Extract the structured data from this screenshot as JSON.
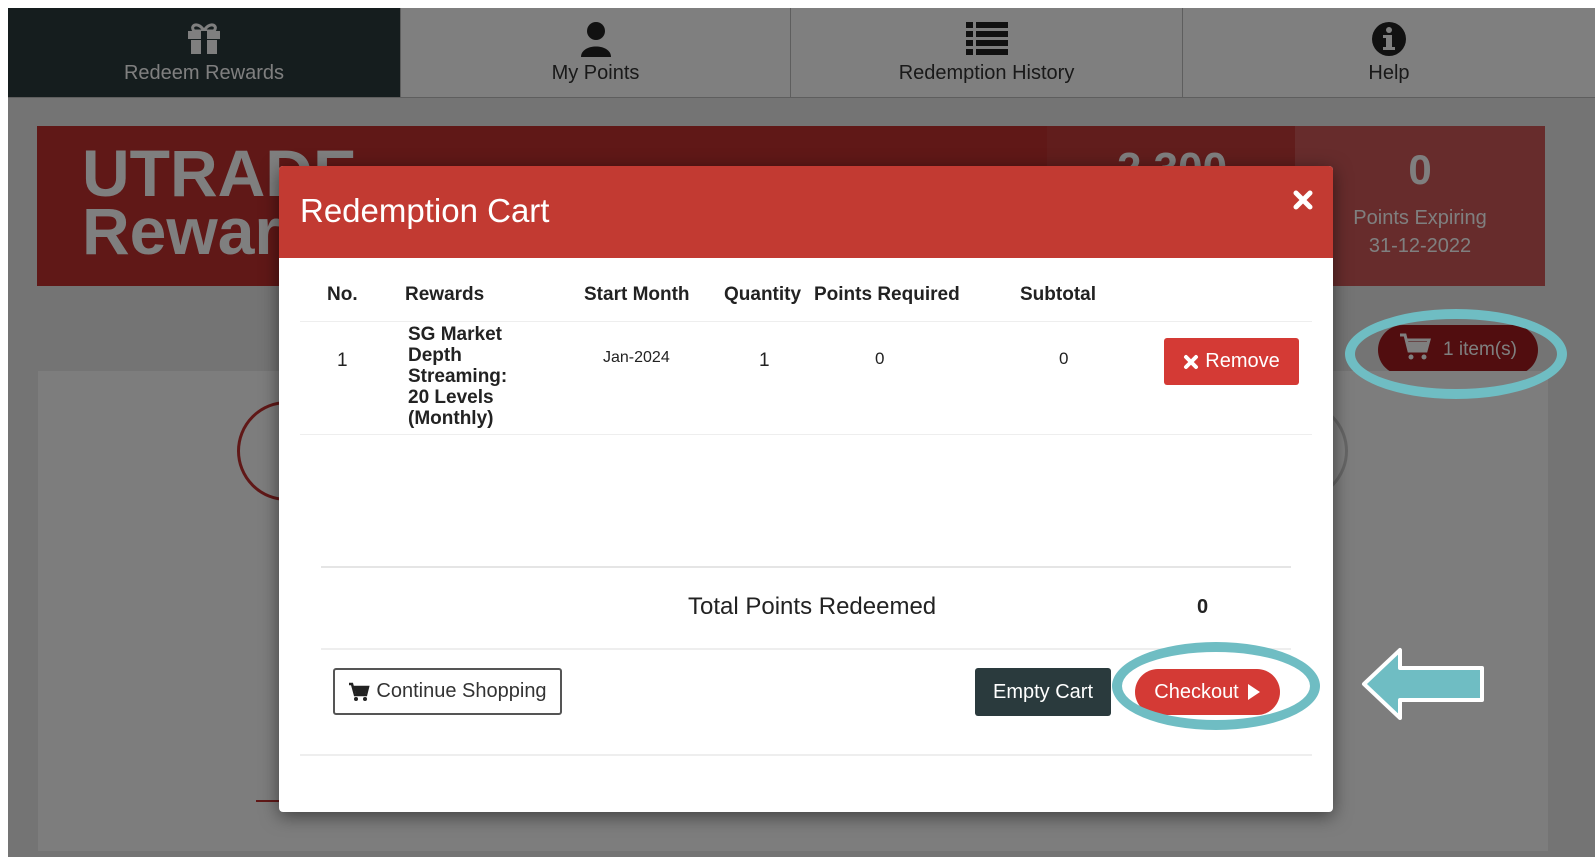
{
  "nav": {
    "tabs": [
      {
        "label": "Redeem Rewards",
        "icon": "gift-icon",
        "active": true
      },
      {
        "label": "My Points",
        "icon": "user-icon",
        "active": false
      },
      {
        "label": "Redemption History",
        "icon": "list-icon",
        "active": false
      },
      {
        "label": "Help",
        "icon": "info-icon",
        "active": false
      }
    ]
  },
  "banner": {
    "title_line1": "UTRADE",
    "title_line2": "Rewards",
    "points_value": "2,300",
    "expiring_value": "0",
    "expiring_label": "Points Expiring",
    "expiring_date": "31-12-2022"
  },
  "cart_summary": {
    "label": "1 item(s)",
    "icon": "cart-icon"
  },
  "modal": {
    "title": "Redemption Cart",
    "close_icon": "close-icon",
    "columns": [
      "No.",
      "Rewards",
      "Start Month",
      "Quantity",
      "Points Required",
      "Subtotal"
    ],
    "rows": [
      {
        "no": "1",
        "reward": "SG Market Depth Streaming: 20 Levels (Monthly)",
        "start_month": "Jan-2024",
        "quantity": "1",
        "points_required": "0",
        "subtotal": "0",
        "remove_label": "Remove"
      }
    ],
    "total_label": "Total Points Redeemed",
    "total_value": "0",
    "continue_label": "Continue Shopping",
    "empty_label": "Empty Cart",
    "checkout_label": "Checkout"
  },
  "colors": {
    "brand_red": "#c23a32",
    "button_red": "#d43a35",
    "dark": "#2a3a3d",
    "annotation": "#6fbdc3"
  }
}
